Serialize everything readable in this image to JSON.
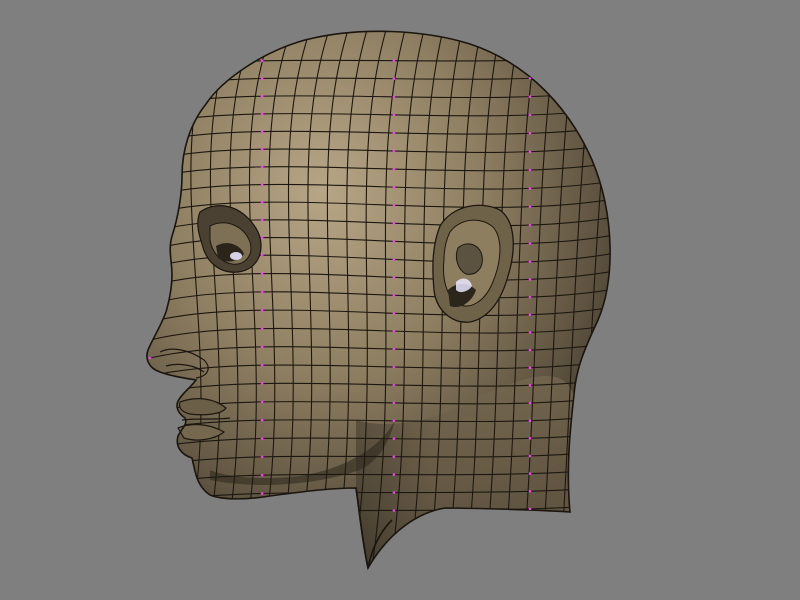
{
  "viewport": {
    "background": "#7f7f7f",
    "view": "side-profile-left",
    "mode": "edit-mesh-subdivision-wireframe"
  },
  "model": {
    "subject": "human-head-and-neck",
    "material": {
      "base": "#8a7a5e",
      "highlight": "#b3a283",
      "shadow": "#3a3326",
      "wire": "#1c1710",
      "vertex": "#ff3cff"
    }
  }
}
